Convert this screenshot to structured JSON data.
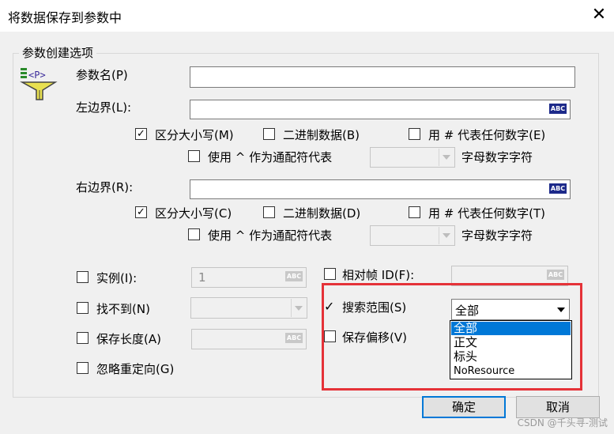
{
  "window": {
    "title": "将数据保存到参数中",
    "close_glyph": "✕"
  },
  "group": {
    "label": "参数创建选项"
  },
  "param_icon": {
    "text": "<P>"
  },
  "param_name": {
    "label": "参数名(P)",
    "value": ""
  },
  "left_boundary": {
    "label": "左边界(L):",
    "value": "",
    "abc": "ABC",
    "case_sensitive": {
      "label": "区分大小写(M)",
      "checked": true
    },
    "binary": {
      "label": "二进制数据(B)",
      "checked": false
    },
    "hash_digit": {
      "label": "用 # 代表任何数字(E)",
      "checked": false
    },
    "caret_wildcard": {
      "label": "使用 ^ 作为通配符代表",
      "checked": false
    },
    "wildcard_value": "",
    "wildcard_suffix": "字母数字字符"
  },
  "right_boundary": {
    "label": "右边界(R):",
    "value": "",
    "abc": "ABC",
    "case_sensitive": {
      "label": "区分大小写(C)",
      "checked": true
    },
    "binary": {
      "label": "二进制数据(D)",
      "checked": false
    },
    "hash_digit": {
      "label": "用 # 代表任何数字(T)",
      "checked": false
    },
    "caret_wildcard": {
      "label": "使用 ^ 作为通配符代表",
      "checked": false
    },
    "wildcard_value": "",
    "wildcard_suffix": "字母数字字符"
  },
  "instance": {
    "label": "实例(I):",
    "value": "1",
    "abc": "ABC",
    "checked": false
  },
  "relative_frame": {
    "label": "相对帧 ID(F):",
    "value": "",
    "abc": "ABC",
    "checked": false
  },
  "not_found": {
    "label": "找不到(N)",
    "value": "",
    "checked": false
  },
  "search_scope": {
    "label": "搜索范围(S)",
    "checked": true,
    "value": "全部",
    "options": [
      "全部",
      "正文",
      "标头",
      "NoResource"
    ]
  },
  "save_length": {
    "label": "保存长度(A)",
    "value": "",
    "abc": "ABC",
    "checked": false
  },
  "save_offset": {
    "label": "保存偏移(V)",
    "checked": false
  },
  "ignore_redirect": {
    "label": "忽略重定向(G)",
    "checked": false
  },
  "buttons": {
    "ok": "确定",
    "cancel": "取消"
  },
  "watermark": "CSDN @千头寻-测试",
  "colors": {
    "highlight_box": "#e53238",
    "selection": "#0078d7",
    "abc_badge": "#1d2a8a"
  }
}
